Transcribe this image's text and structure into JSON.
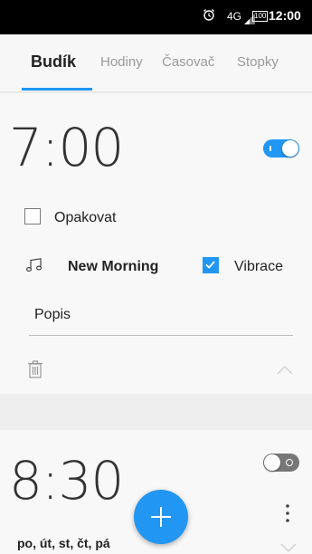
{
  "status_bar": {
    "network": "4G",
    "battery": "100",
    "time": "12:00"
  },
  "tabs": [
    {
      "label": "Budík",
      "active": true
    },
    {
      "label": "Hodiny",
      "active": false
    },
    {
      "label": "Časovač",
      "active": false
    },
    {
      "label": "Stopky",
      "active": false
    }
  ],
  "alarms": [
    {
      "time": "7:00",
      "enabled": true,
      "repeat_label": "Opakovat",
      "repeat_checked": false,
      "ringtone": "New Morning",
      "vibrate_label": "Vibrace",
      "vibrate_checked": true,
      "description_label": "Popis",
      "expanded": true
    },
    {
      "time": "8:30",
      "enabled": false,
      "days": "po, út, st, čt, pá",
      "expanded": false
    }
  ],
  "colors": {
    "accent": "#2196f3",
    "status_bar": "#000000",
    "background": "#eeeeee"
  },
  "icons": {
    "alarm": "alarm-clock-icon",
    "signal": "signal-icon",
    "battery": "battery-icon",
    "music": "music-note-icon",
    "delete": "trash-icon",
    "collapse": "chevron-up-icon",
    "expand": "chevron-down-icon",
    "more": "more-vertical-icon",
    "add": "plus-icon"
  }
}
